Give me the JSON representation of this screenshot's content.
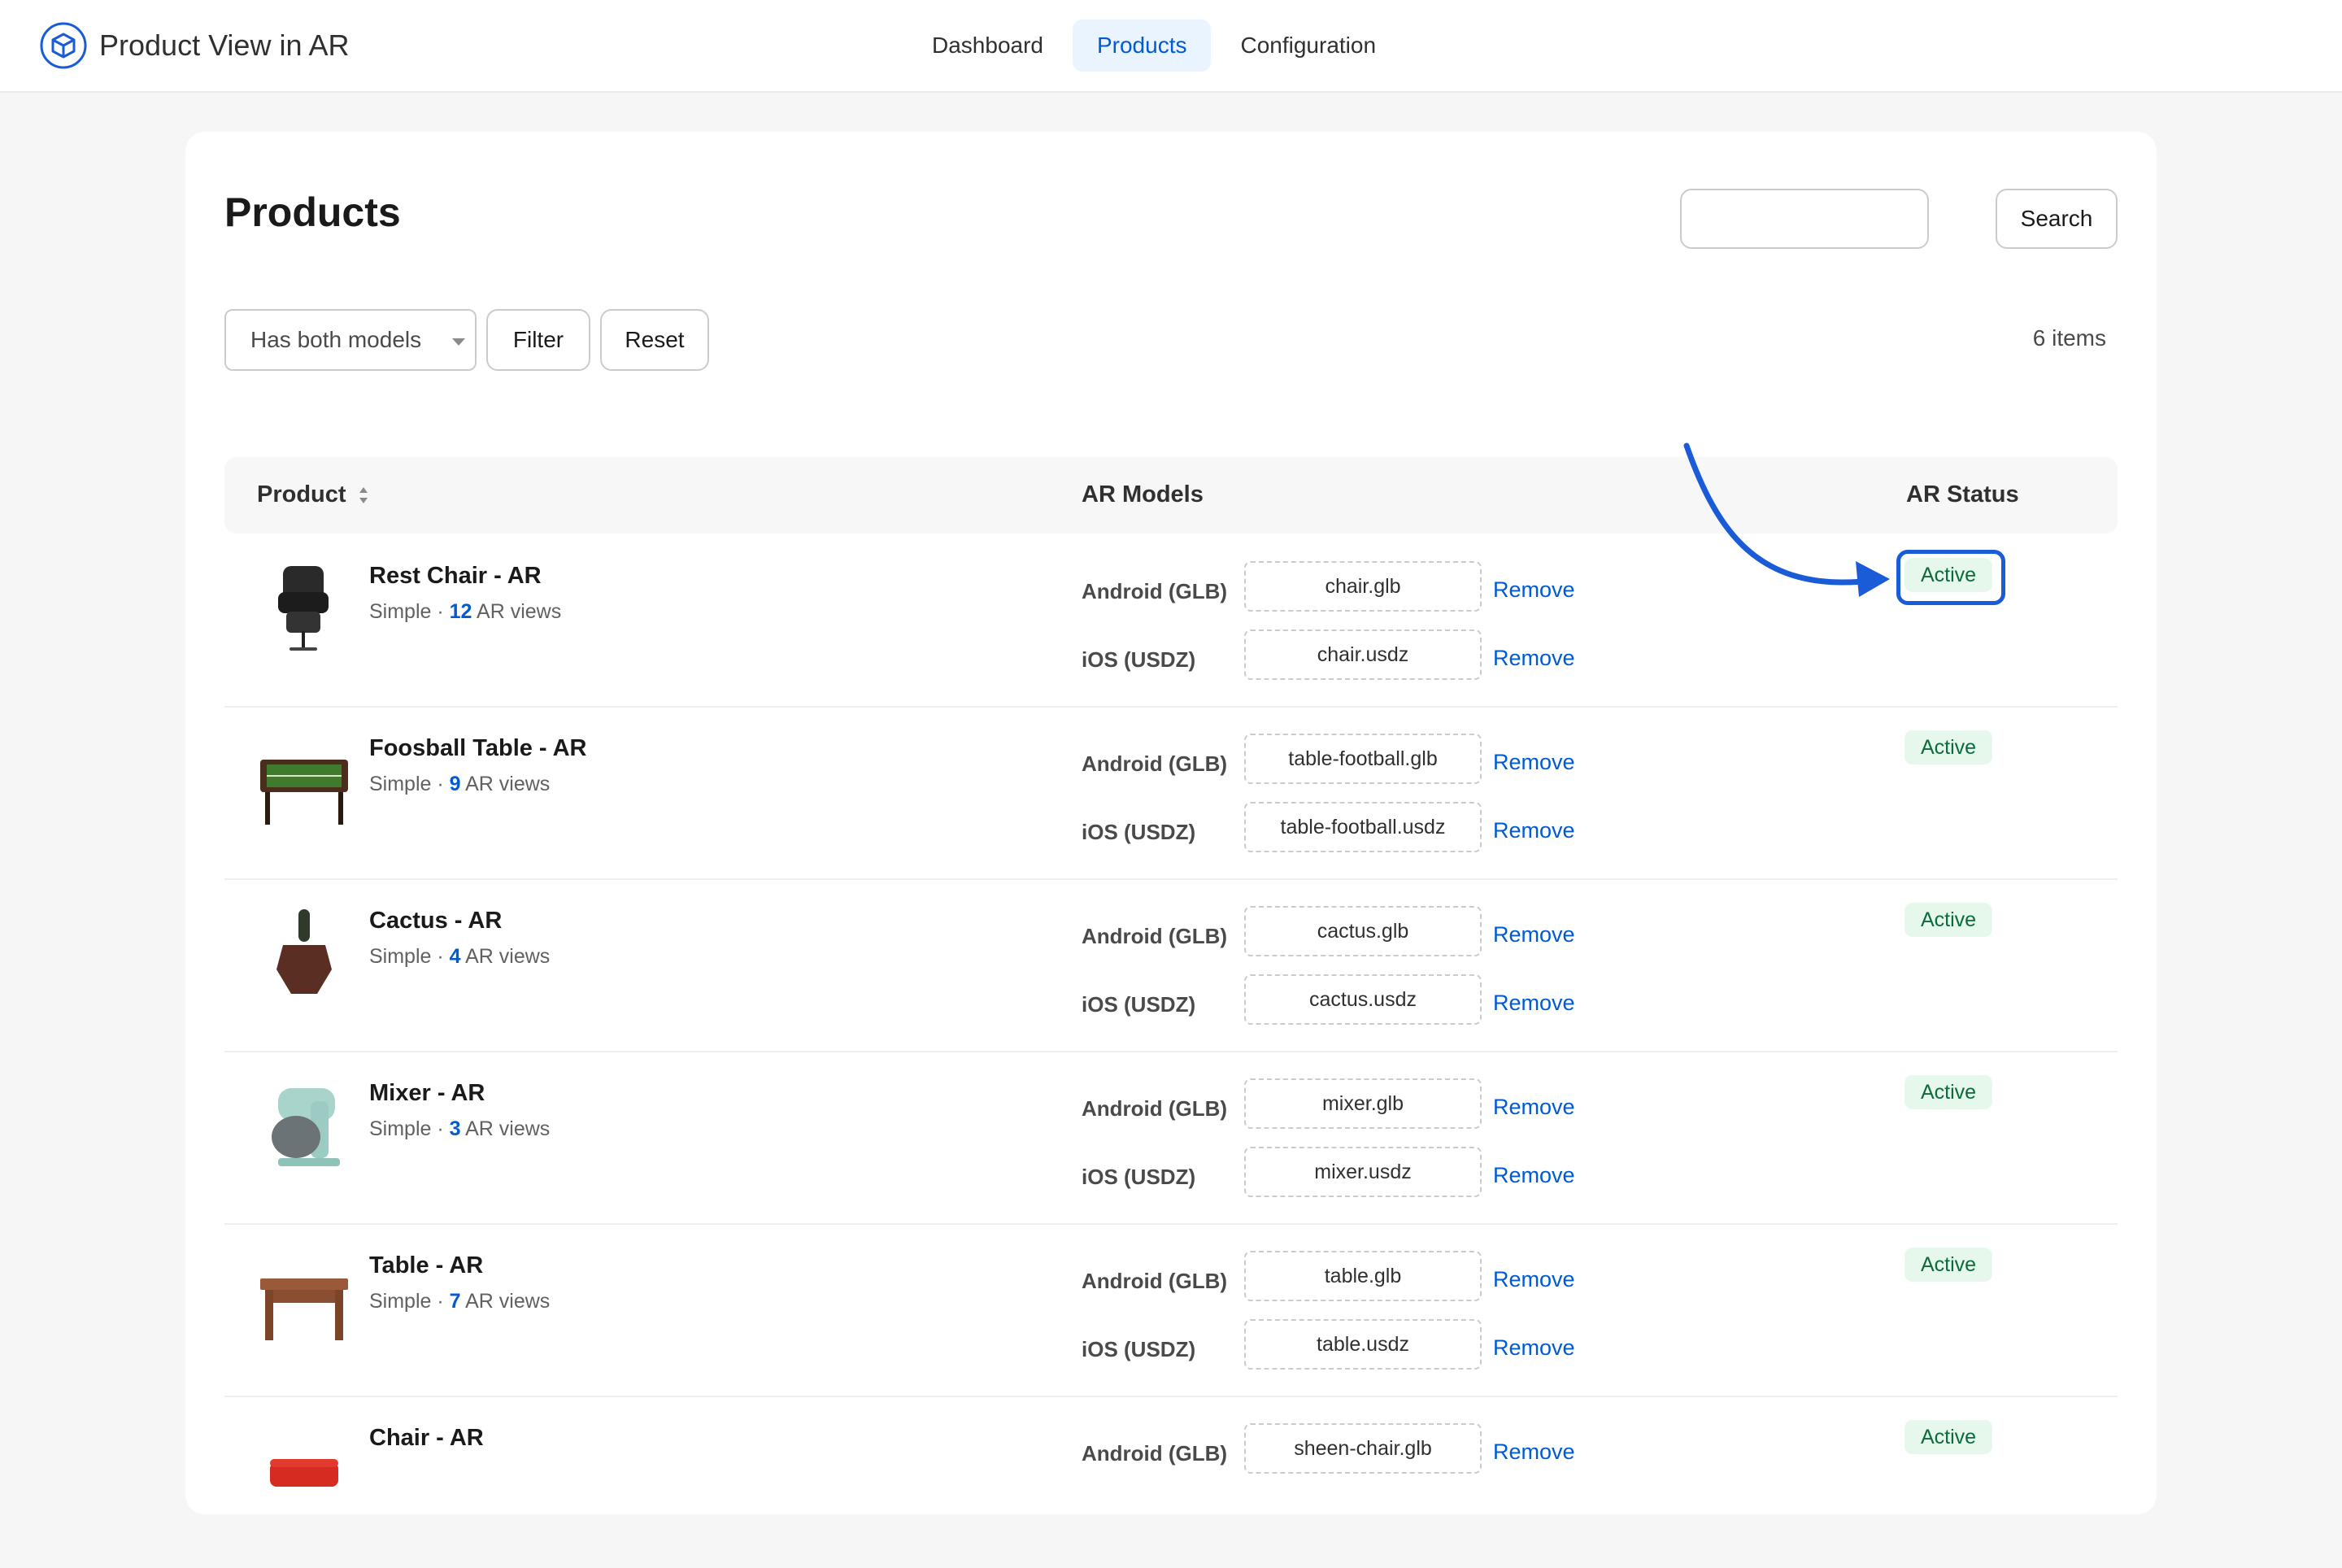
{
  "app": {
    "title": "Product View in AR"
  },
  "nav": {
    "items": [
      "Dashboard",
      "Products",
      "Configuration"
    ],
    "active": "Products"
  },
  "page": {
    "title": "Products",
    "search": {
      "value": "",
      "placeholder": "",
      "button_label": "Search"
    },
    "filter": {
      "selected": "Has both models",
      "filter_label": "Filter",
      "reset_label": "Reset"
    },
    "item_count": "6 items"
  },
  "table": {
    "headers": {
      "product": "Product",
      "models": "AR Models",
      "status": "AR Status"
    },
    "rows": [
      {
        "name": "Rest Chair - AR",
        "type": "Simple",
        "views": "12",
        "views_suffix": "AR views",
        "android_label": "Android (GLB)",
        "android_file": "chair.glb",
        "ios_label": "iOS (USDZ)",
        "ios_file": "chair.usdz",
        "remove_label": "Remove",
        "status": "Active"
      },
      {
        "name": "Foosball Table - AR",
        "type": "Simple",
        "views": "9",
        "views_suffix": "AR views",
        "android_label": "Android (GLB)",
        "android_file": "table-football.glb",
        "ios_label": "iOS (USDZ)",
        "ios_file": "table-football.usdz",
        "remove_label": "Remove",
        "status": "Active"
      },
      {
        "name": "Cactus - AR",
        "type": "Simple",
        "views": "4",
        "views_suffix": "AR views",
        "android_label": "Android (GLB)",
        "android_file": "cactus.glb",
        "ios_label": "iOS (USDZ)",
        "ios_file": "cactus.usdz",
        "remove_label": "Remove",
        "status": "Active"
      },
      {
        "name": "Mixer - AR",
        "type": "Simple",
        "views": "3",
        "views_suffix": "AR views",
        "android_label": "Android (GLB)",
        "android_file": "mixer.glb",
        "ios_label": "iOS (USDZ)",
        "ios_file": "mixer.usdz",
        "remove_label": "Remove",
        "status": "Active"
      },
      {
        "name": "Table - AR",
        "type": "Simple",
        "views": "7",
        "views_suffix": "AR views",
        "android_label": "Android (GLB)",
        "android_file": "table.glb",
        "ios_label": "iOS (USDZ)",
        "ios_file": "table.usdz",
        "remove_label": "Remove",
        "status": "Active"
      },
      {
        "name": "Chair - AR",
        "type": "",
        "views": "",
        "views_suffix": "",
        "android_label": "Android (GLB)",
        "android_file": "sheen-chair.glb",
        "ios_label": "",
        "ios_file": "",
        "remove_label": "Remove",
        "status": "Active"
      }
    ]
  },
  "colors": {
    "accent": "#005bd3",
    "annotation": "#1a5bd8",
    "active_badge_bg": "#e6f7ec",
    "active_badge_text": "#0c6b3a"
  },
  "icons": {
    "brand": "cube-icon",
    "sort": "sort-icon",
    "annotation": "arrow-annotation"
  }
}
